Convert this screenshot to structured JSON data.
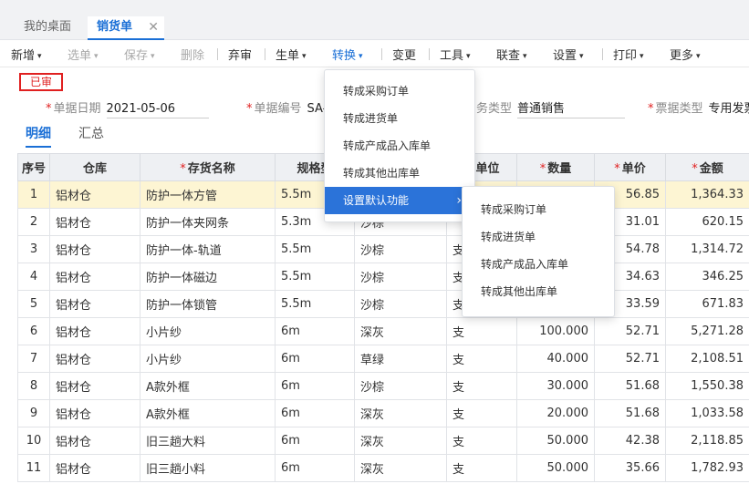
{
  "tabs": {
    "home": "我的桌面",
    "active": "销货单",
    "close": "✕"
  },
  "toolbar": {
    "add": "新增",
    "select": "选单",
    "save": "保存",
    "delete": "删除",
    "abandon": "弃审",
    "generate": "生单",
    "convert": "转换",
    "change": "变更",
    "tools": "工具",
    "linked": "联查",
    "settings": "设置",
    "print": "打印",
    "more": "更多",
    "caret": "⌄"
  },
  "status_stamp": "已审",
  "form": {
    "date_label": "单据日期",
    "date_value": "2021-05-06",
    "code_label": "单据编号",
    "code_value": "SA-",
    "biz_type_label": "务类型",
    "biz_type_value": "普通销售",
    "invoice_type_label": "票据类型",
    "invoice_type_value": "专用发票"
  },
  "subtabs": {
    "detail": "明细",
    "summary": "汇总"
  },
  "table": {
    "headers": [
      "序号",
      "仓库",
      "存货名称",
      "规格型",
      "",
      "售单位",
      "数量",
      "单价",
      "金额"
    ],
    "required_cols": [
      2,
      6,
      7,
      8
    ],
    "rows": [
      [
        "1",
        "铝材仓",
        "防护一体方管",
        "5.5m",
        "",
        "",
        "",
        "56.85",
        "1,364.33"
      ],
      [
        "2",
        "铝材仓",
        "防护一体夹网条",
        "5.3m",
        "沙棕",
        "",
        "",
        "31.01",
        "620.15"
      ],
      [
        "3",
        "铝材仓",
        "防护一体-轨道",
        "5.5m",
        "沙棕",
        "支",
        "",
        "54.78",
        "1,314.72"
      ],
      [
        "4",
        "铝材仓",
        "防护一体磁边",
        "5.5m",
        "沙棕",
        "支",
        "",
        "34.63",
        "346.25"
      ],
      [
        "5",
        "铝材仓",
        "防护一体锁管",
        "5.5m",
        "沙棕",
        "支",
        "",
        "33.59",
        "671.83"
      ],
      [
        "6",
        "铝材仓",
        "小片纱",
        "6m",
        "深灰",
        "支",
        "100.000",
        "52.71",
        "5,271.28"
      ],
      [
        "7",
        "铝材仓",
        "小片纱",
        "6m",
        "草绿",
        "支",
        "40.000",
        "52.71",
        "2,108.51"
      ],
      [
        "8",
        "铝材仓",
        "A款外框",
        "6m",
        "沙棕",
        "支",
        "30.000",
        "51.68",
        "1,550.38"
      ],
      [
        "9",
        "铝材仓",
        "A款外框",
        "6m",
        "深灰",
        "支",
        "20.000",
        "51.68",
        "1,033.58"
      ],
      [
        "10",
        "铝材仓",
        "旧三趟大料",
        "6m",
        "深灰",
        "支",
        "50.000",
        "42.38",
        "2,118.85"
      ],
      [
        "11",
        "铝材仓",
        "旧三趟小料",
        "6m",
        "深灰",
        "支",
        "50.000",
        "35.66",
        "1,782.93"
      ]
    ]
  },
  "convert_menu": {
    "items": [
      "转成采购订单",
      "转成进货单",
      "转成产成品入库单",
      "转成其他出库单",
      "设置默认功能"
    ],
    "arrow": "›"
  },
  "submenu": {
    "items": [
      "转成采购订单",
      "转成进货单",
      "转成产成品入库单",
      "转成其他出库单"
    ]
  }
}
